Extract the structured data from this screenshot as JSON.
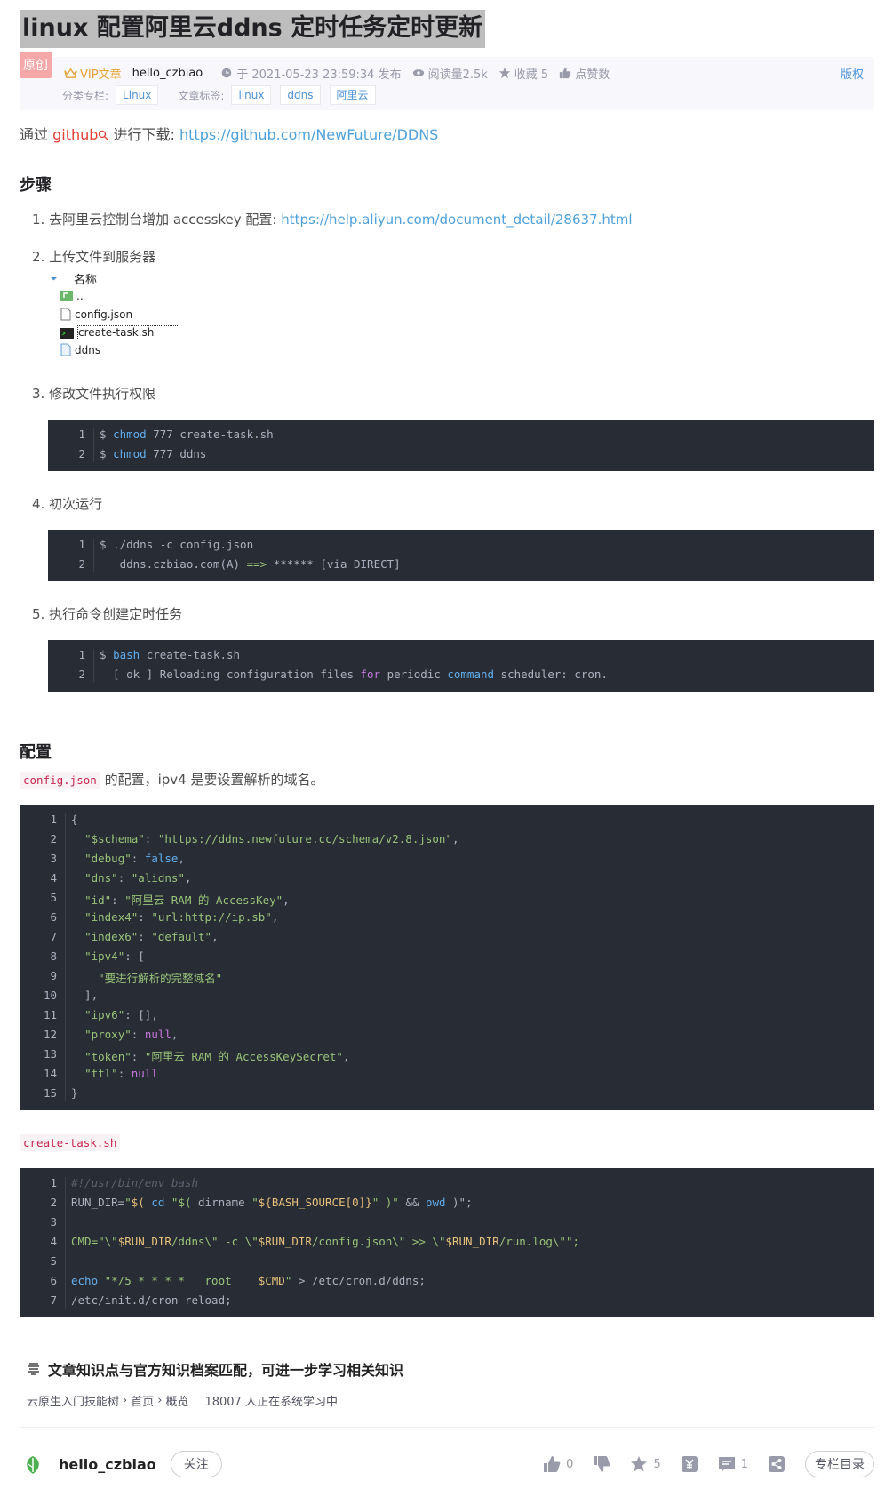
{
  "article": {
    "title": "linux 配置阿里云ddns 定时任务定时更新",
    "original_badge": "原创",
    "vip_label": "VIP文章",
    "author": "hello_czbiao",
    "published": "于 2021-05-23 23:59:34 发布",
    "read_count": "阅读量2.5k",
    "favorites": "收藏 5",
    "likes": "点赞数",
    "copyright": "版权",
    "category_label": "分类专栏:",
    "categories": [
      "Linux"
    ],
    "tags_label": "文章标签:",
    "tags": [
      "linux",
      "ddns",
      "阿里云"
    ]
  },
  "content": {
    "intro_prefix": "通过",
    "intro_keyword": "github",
    "intro_mid": "进行下载:",
    "intro_link": "https://github.com/NewFuture/DDNS",
    "steps_heading": "步骤",
    "step1_text": "1. 去阿里云控制台增加 accesskey 配置:",
    "step1_link": "https://help.aliyun.com/document_detail/28637.html",
    "step2_text": "2. 上传文件到服务器",
    "filetree": {
      "header": "名称",
      "items": [
        "..",
        "config.json",
        "create-task.sh",
        "ddns"
      ]
    },
    "step3_text": "3. 修改文件执行权限",
    "step4_text": "4. 初次运行",
    "step5_text": "5. 执行命令创建定时任务",
    "config_heading": "配置",
    "config_desc_code": "config.json",
    "config_desc_text": "的配置，ipv4 是要设置解析的域名。",
    "create_task_code": "create-task.sh"
  },
  "code_blocks": {
    "chmod": {
      "line_numbers": [
        "1",
        "2"
      ],
      "lines": [
        [
          {
            "t": "$ ",
            "c": "pn"
          },
          {
            "t": "chmod",
            "c": "k"
          },
          {
            "t": " 777 create-task.sh",
            "c": "pn"
          }
        ],
        [
          {
            "t": "$ ",
            "c": "pn"
          },
          {
            "t": "chmod",
            "c": "k"
          },
          {
            "t": " 777 ddns",
            "c": "pn"
          }
        ]
      ]
    },
    "run": {
      "line_numbers": [
        "1",
        "2"
      ],
      "lines": [
        [
          {
            "t": "$ ./ddns -c config.json",
            "c": "pn"
          }
        ],
        [
          {
            "t": "   ddns.czbiao.com(A) ",
            "c": "pn"
          },
          {
            "t": "==>",
            "c": "str"
          },
          {
            "t": " ****** [via DIRECT]",
            "c": "pn"
          }
        ]
      ]
    },
    "bash": {
      "line_numbers": [
        "1",
        "2"
      ],
      "lines": [
        [
          {
            "t": "$ ",
            "c": "pn"
          },
          {
            "t": "bash",
            "c": "k"
          },
          {
            "t": " create-task.sh",
            "c": "pn"
          }
        ],
        [
          {
            "t": "  [ ok ] Reloading configuration files ",
            "c": "pn"
          },
          {
            "t": "for",
            "c": "kw"
          },
          {
            "t": " periodic ",
            "c": "pn"
          },
          {
            "t": "command",
            "c": "k"
          },
          {
            "t": " scheduler: cron.",
            "c": "pn"
          }
        ]
      ]
    },
    "config": {
      "line_numbers": [
        "1",
        "2",
        "3",
        "4",
        "5",
        "6",
        "7",
        "8",
        "9",
        "10",
        "11",
        "12",
        "13",
        "14",
        "15"
      ],
      "lines": [
        [
          {
            "t": "{",
            "c": "pn"
          }
        ],
        [
          {
            "t": "  ",
            "c": "pn"
          },
          {
            "t": "\"$schema\"",
            "c": "attr"
          },
          {
            "t": ": ",
            "c": "pn"
          },
          {
            "t": "\"https://ddns.newfuture.cc/schema/v2.8.json\"",
            "c": "str"
          },
          {
            "t": ",",
            "c": "pn"
          }
        ],
        [
          {
            "t": "  ",
            "c": "pn"
          },
          {
            "t": "\"debug\"",
            "c": "attr"
          },
          {
            "t": ": ",
            "c": "pn"
          },
          {
            "t": "false",
            "c": "k"
          },
          {
            "t": ",",
            "c": "pn"
          }
        ],
        [
          {
            "t": "  ",
            "c": "pn"
          },
          {
            "t": "\"dns\"",
            "c": "attr"
          },
          {
            "t": ": ",
            "c": "pn"
          },
          {
            "t": "\"alidns\"",
            "c": "str"
          },
          {
            "t": ",",
            "c": "pn"
          }
        ],
        [
          {
            "t": "  ",
            "c": "pn"
          },
          {
            "t": "\"id\"",
            "c": "attr"
          },
          {
            "t": ": ",
            "c": "pn"
          },
          {
            "t": "\"阿里云 RAM 的 AccessKey\"",
            "c": "str"
          },
          {
            "t": ",",
            "c": "pn"
          }
        ],
        [
          {
            "t": "  ",
            "c": "pn"
          },
          {
            "t": "\"index4\"",
            "c": "attr"
          },
          {
            "t": ": ",
            "c": "pn"
          },
          {
            "t": "\"url:http://ip.sb\"",
            "c": "str"
          },
          {
            "t": ",",
            "c": "pn"
          }
        ],
        [
          {
            "t": "  ",
            "c": "pn"
          },
          {
            "t": "\"index6\"",
            "c": "attr"
          },
          {
            "t": ": ",
            "c": "pn"
          },
          {
            "t": "\"default\"",
            "c": "str"
          },
          {
            "t": ",",
            "c": "pn"
          }
        ],
        [
          {
            "t": "  ",
            "c": "pn"
          },
          {
            "t": "\"ipv4\"",
            "c": "attr"
          },
          {
            "t": ": [",
            "c": "pn"
          }
        ],
        [
          {
            "t": "    ",
            "c": "pn"
          },
          {
            "t": "\"要进行解析的完整域名\"",
            "c": "str"
          }
        ],
        [
          {
            "t": "  ],",
            "c": "pn"
          }
        ],
        [
          {
            "t": "  ",
            "c": "pn"
          },
          {
            "t": "\"ipv6\"",
            "c": "attr"
          },
          {
            "t": ": [],",
            "c": "pn"
          }
        ],
        [
          {
            "t": "  ",
            "c": "pn"
          },
          {
            "t": "\"proxy\"",
            "c": "attr"
          },
          {
            "t": ": ",
            "c": "pn"
          },
          {
            "t": "null",
            "c": "kw"
          },
          {
            "t": ",",
            "c": "pn"
          }
        ],
        [
          {
            "t": "  ",
            "c": "pn"
          },
          {
            "t": "\"token\"",
            "c": "attr"
          },
          {
            "t": ": ",
            "c": "pn"
          },
          {
            "t": "\"阿里云 RAM 的 AccessKeySecret\"",
            "c": "str"
          },
          {
            "t": ",",
            "c": "pn"
          }
        ],
        [
          {
            "t": "  ",
            "c": "pn"
          },
          {
            "t": "\"ttl\"",
            "c": "attr"
          },
          {
            "t": ": ",
            "c": "pn"
          },
          {
            "t": "null",
            "c": "kw"
          }
        ],
        [
          {
            "t": "}",
            "c": "pn"
          }
        ]
      ]
    },
    "task": {
      "line_numbers": [
        "1",
        "2",
        "3",
        "4",
        "5",
        "6",
        "7"
      ],
      "lines": [
        [
          {
            "t": "#!/usr/bin/env bash",
            "c": "cmt"
          }
        ],
        [
          {
            "t": "RUN_DIR=",
            "c": "pn"
          },
          {
            "t": "\"",
            "c": "str"
          },
          {
            "t": "$(",
            "c": "var"
          },
          {
            "t": " cd ",
            "c": "k"
          },
          {
            "t": "\"$(",
            "c": "str"
          },
          {
            "t": " dirname ",
            "c": "pn"
          },
          {
            "t": "\"",
            "c": "str"
          },
          {
            "t": "${BASH_SOURCE[0]}",
            "c": "var"
          },
          {
            "t": "\"",
            "c": "str"
          },
          {
            "t": " )\"",
            "c": "str"
          },
          {
            "t": " && ",
            "c": "pn"
          },
          {
            "t": "pwd",
            "c": "k"
          },
          {
            "t": " )\";",
            "c": "pn"
          }
        ],
        [
          {
            "t": "",
            "c": "pn"
          }
        ],
        [
          {
            "t": "CMD=",
            "c": "str"
          },
          {
            "t": "\"\\\"",
            "c": "str"
          },
          {
            "t": "$RUN_DIR",
            "c": "var"
          },
          {
            "t": "/ddns\\\" -c \\\"",
            "c": "str"
          },
          {
            "t": "$RUN_DIR",
            "c": "var"
          },
          {
            "t": "/config.json\\\" >> \\\"",
            "c": "str"
          },
          {
            "t": "$RUN_DIR",
            "c": "var"
          },
          {
            "t": "/run.log\\\"\";",
            "c": "str"
          }
        ],
        [
          {
            "t": "",
            "c": "pn"
          }
        ],
        [
          {
            "t": "echo",
            "c": "k"
          },
          {
            "t": " \"*/5 * * * *   root    ",
            "c": "str"
          },
          {
            "t": "$CMD",
            "c": "var"
          },
          {
            "t": "\"",
            "c": "str"
          },
          {
            "t": " > /etc/cron.d/ddns;",
            "c": "pn"
          }
        ],
        [
          {
            "t": "/etc/init.d/cron reload;",
            "c": "pn"
          }
        ]
      ]
    }
  },
  "knowledge": {
    "title": "文章知识点与官方知识档案匹配，可进一步学习相关知识",
    "path": [
      "云原生入门技能树",
      "首页",
      "概览"
    ],
    "learners": "18007 人正在系统学习中"
  },
  "toolbar": {
    "author": "hello_czbiao",
    "follow_label": "关注",
    "like_count": "0",
    "favorite_count": "5",
    "comment_count": "1",
    "column_label": "专栏目录"
  },
  "colors": {
    "link": "#4ea1db",
    "code_bg": "#282c34",
    "title_highlight": "#bdbdbd"
  }
}
